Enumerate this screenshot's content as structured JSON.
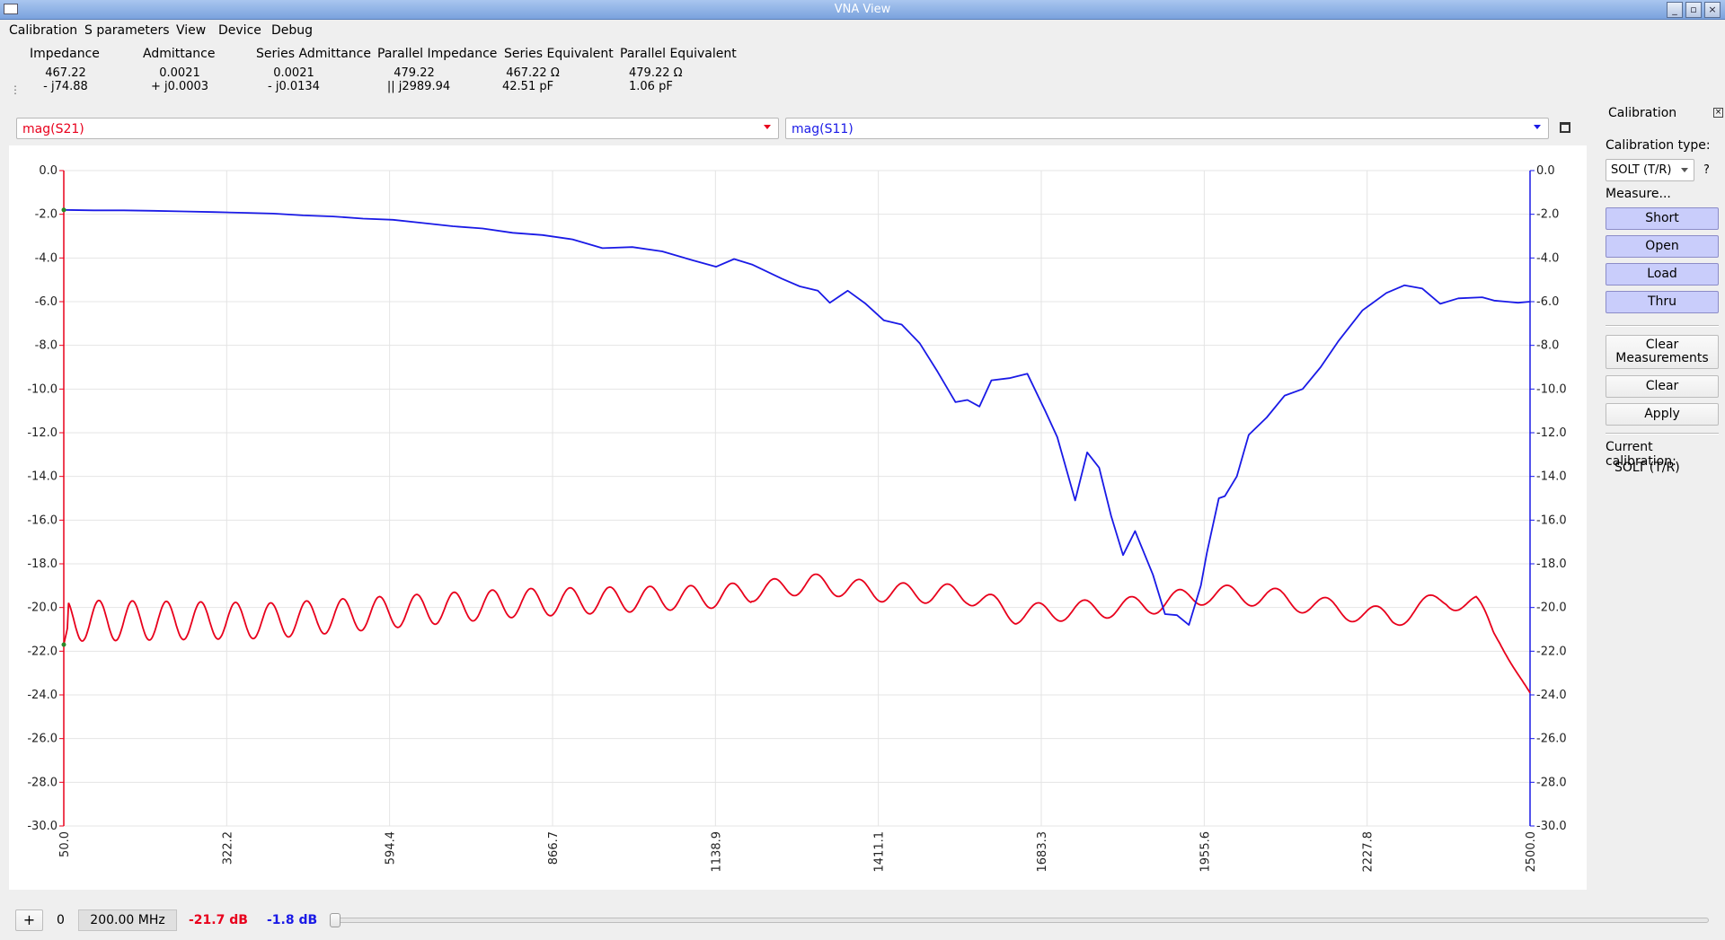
{
  "window": {
    "title": "VNA View",
    "buttons": [
      "_",
      "▫",
      "×"
    ]
  },
  "menu": [
    "Calibration",
    "S parameters",
    "View",
    "Device",
    "Debug"
  ],
  "info": [
    {
      "header": "Impedance",
      "line1": "467.22",
      "line2": "- j74.88"
    },
    {
      "header": "Admittance",
      "line1": "0.0021",
      "line2": "+ j0.0003"
    },
    {
      "header": "Series Admittance",
      "line1": "0.0021",
      "line2": "- j0.0134"
    },
    {
      "header": "Parallel Impedance",
      "line1": "479.22",
      "line2": "|| j2989.94"
    },
    {
      "header": "Series Equivalent",
      "line1": "467.22 Ω",
      "line2": "42.51 pF"
    },
    {
      "header": "Parallel Equivalent",
      "line1": "479.22 Ω",
      "line2": "1.06 pF"
    }
  ],
  "trace_selectors": {
    "left": {
      "value": "mag(S21)",
      "color": "#e8001c"
    },
    "right": {
      "value": "mag(S11)",
      "color": "#1a1ae6"
    }
  },
  "calibration": {
    "title": "Calibration",
    "type_label": "Calibration type:",
    "type_value": "SOLT (T/R)",
    "help": "?",
    "measure_label": "Measure...",
    "measure_buttons": [
      "Short",
      "Open",
      "Load",
      "Thru"
    ],
    "clear_measurements_l1": "Clear",
    "clear_measurements_l2": "Measurements",
    "clear": "Clear",
    "apply": "Apply",
    "current_label": "Current calibration:",
    "current_value": "SOLT (T/R)"
  },
  "bottom": {
    "add": "+",
    "marker_index": "0",
    "frequency": "200.00 MHz",
    "s21_value": "-21.7 dB",
    "s11_value": "-1.8 dB",
    "slider_position": 0
  },
  "chart_data": {
    "type": "line",
    "xlim": [
      50,
      2500
    ],
    "ylim": [
      -30,
      0
    ],
    "x_ticks": [
      "50.0",
      "322.2",
      "594.4",
      "866.7",
      "1138.9",
      "1411.1",
      "1683.3",
      "1955.6",
      "2227.8",
      "2500.0"
    ],
    "y_ticks_left": [
      "0.0",
      "-2.0",
      "-4.0",
      "-6.0",
      "-8.0",
      "-10.0",
      "-12.0",
      "-14.0",
      "-16.0",
      "-18.0",
      "-20.0",
      "-22.0",
      "-24.0",
      "-26.0",
      "-28.0",
      "-30.0"
    ],
    "y_ticks_right": [
      "0.0",
      "-2.0",
      "-4.0",
      "-6.0",
      "-8.0",
      "-10.0",
      "-12.0",
      "-14.0",
      "-16.0",
      "-18.0",
      "-20.0",
      "-22.0",
      "-24.0",
      "-26.0",
      "-28.0",
      "-30.0"
    ],
    "grid": true,
    "colors": {
      "s21": "#e8001c",
      "s11": "#1a1ae6"
    },
    "series": [
      {
        "name": "mag(S11)",
        "axis": "right",
        "x": [
          50,
          100,
          150,
          200,
          250,
          300,
          350,
          400,
          450,
          500,
          550,
          600,
          650,
          700,
          750,
          800,
          850,
          900,
          950,
          1000,
          1050,
          1100,
          1140,
          1170,
          1200,
          1250,
          1280,
          1310,
          1330,
          1360,
          1390,
          1420,
          1450,
          1480,
          1510,
          1540,
          1560,
          1580,
          1600,
          1630,
          1660,
          1690,
          1710,
          1740,
          1760,
          1780,
          1800,
          1820,
          1840,
          1870,
          1890,
          1910,
          1930,
          1950,
          1960,
          1980,
          1990,
          2010,
          2030,
          2060,
          2090,
          2120,
          2150,
          2180,
          2220,
          2260,
          2290,
          2320,
          2350,
          2380,
          2420,
          2440,
          2460,
          2480,
          2500
        ],
        "y": [
          -1.8,
          -1.82,
          -1.82,
          -1.84,
          -1.87,
          -1.9,
          -1.93,
          -1.97,
          -2.05,
          -2.1,
          -2.2,
          -2.25,
          -2.4,
          -2.55,
          -2.65,
          -2.85,
          -2.95,
          -3.15,
          -3.55,
          -3.5,
          -3.7,
          -4.1,
          -4.4,
          -4.05,
          -4.3,
          -4.95,
          -5.3,
          -5.5,
          -6.05,
          -5.5,
          -6.1,
          -6.85,
          -7.05,
          -7.9,
          -9.2,
          -10.6,
          -10.5,
          -10.8,
          -9.6,
          -9.5,
          -9.3,
          -11.0,
          -12.2,
          -15.1,
          -12.9,
          -13.6,
          -15.8,
          -17.6,
          -16.5,
          -18.5,
          -20.3,
          -20.35,
          -20.8,
          -19.0,
          -17.5,
          -15.0,
          -14.9,
          -14.0,
          -12.1,
          -11.3,
          -10.3,
          -10.0,
          -9.0,
          -7.8,
          -6.4,
          -5.6,
          -5.25,
          -5.4,
          -6.1,
          -5.85,
          -5.8,
          -5.95,
          -6.0,
          -6.05,
          -6.0
        ]
      }
    ]
  }
}
